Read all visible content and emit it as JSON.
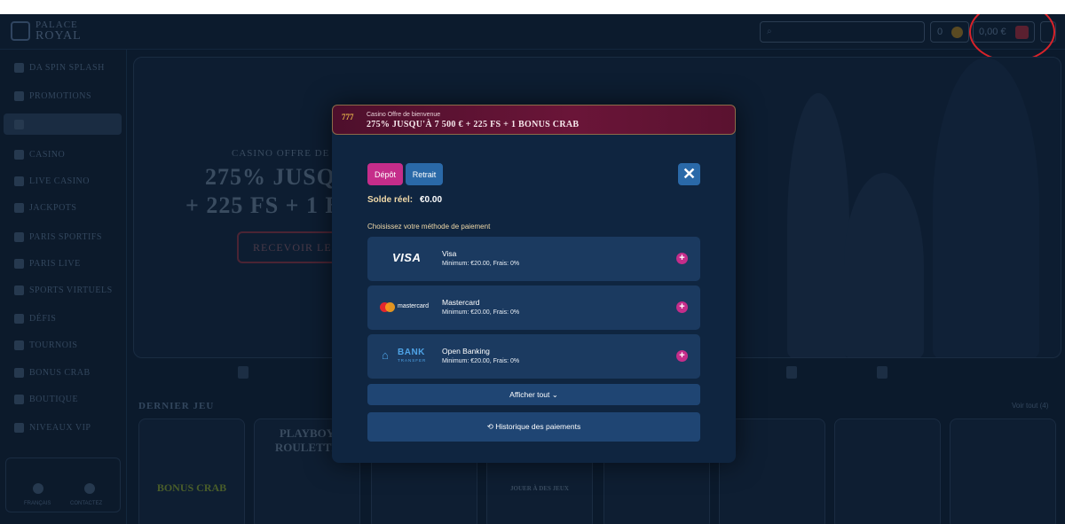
{
  "header": {
    "logo_line1": "PALACE",
    "logo_line2": "ROYAL",
    "coins": "0",
    "balance": "0,00 €"
  },
  "sidebar": {
    "items": [
      {
        "label": "DA SPIN SPLASH"
      },
      {
        "label": "PROMOTIONS"
      },
      {
        "label": ""
      },
      {
        "label": "CASINO"
      },
      {
        "label": "LIVE CASINO"
      },
      {
        "label": "JACKPOTS"
      },
      {
        "label": "PARIS SPORTIFS"
      },
      {
        "label": "PARIS LIVE"
      },
      {
        "label": "SPORTS VIRTUELS"
      },
      {
        "label": "DÉFIS"
      },
      {
        "label": "TOURNOIS"
      },
      {
        "label": "BONUS CRAB"
      },
      {
        "label": "BOUTIQUE"
      },
      {
        "label": "NIVEAUX VIP"
      }
    ],
    "footer_language": "FRANÇAIS",
    "footer_contact": "CONTACTEZ"
  },
  "background": {
    "hero_subtitle": "CASINO OFFRE DE",
    "hero_title_line1": "275% JUSQU",
    "hero_title_line2": "+ 225 FS + 1 BO",
    "hero_button": "RECEVOIR LE",
    "last_game_title": "DERNIER JEU",
    "see_all": "Voir tout (4)",
    "tile_playboy": "PLAYBOY ROULETTE",
    "tile_bonus_crab": "BONUS CRAB",
    "tile_play_games": "JOUER À DES JEUX"
  },
  "modal": {
    "banner_small": "Casino Offre de bienvenue",
    "banner_main": "275% JUSQU'À 7 500 € + 225 FS + 1 BONUS CRAB",
    "banner_badge": "777",
    "tab_depot": "Dépôt",
    "tab_retrait": "Retrait",
    "close_symbol": "✕",
    "balance_label": "Solde réel:",
    "balance_value": "€0.00",
    "method_prompt": "Choisissez votre méthode de paiement",
    "methods": [
      {
        "name": "Visa",
        "details": "Minimum: €20.00, Frais: 0%",
        "logo_text": "VISA"
      },
      {
        "name": "Mastercard",
        "details": "Minimum: €20.00, Frais: 0%",
        "logo_text": "mastercard"
      },
      {
        "name": "Open Banking",
        "details": "Minimum: €20.00, Frais: 0%",
        "logo_text": "BANK",
        "logo_sub": "TRANSFER"
      }
    ],
    "show_all": "Afficher tout ⌄",
    "history": "Historique des paiements",
    "accent_pink": "#c52d8a",
    "accent_blue": "#2a69a8"
  }
}
